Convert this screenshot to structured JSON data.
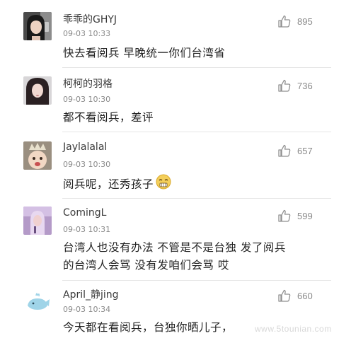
{
  "comments": [
    {
      "username": "乖乖的GHYJ",
      "time": "09-03 10:33",
      "text_lines": [
        "快去看阅兵 早晚统一你们台湾省"
      ],
      "likes": "895",
      "avatar_icon": "avatar-girl-dark-hair-photo"
    },
    {
      "username": "柯柯的羽格",
      "time": "09-03 10:30",
      "text_lines": [
        "都不看阅兵，差评"
      ],
      "likes": "736",
      "avatar_icon": "avatar-girl-long-hair-photo"
    },
    {
      "username": "Jaylalalal",
      "time": "09-03 10:30",
      "text_lines": [
        "阅兵呢，还秀孩子"
      ],
      "likes": "657",
      "avatar_icon": "avatar-baby-crown-photo",
      "emoji_icon": "smirk-emoji"
    },
    {
      "username": "ComingL",
      "time": "09-03 10:31",
      "text_lines": [
        "台湾人也没有办法 不管是不是台独 发了阅兵",
        "的台湾人会骂 没有发咱们会骂 哎"
      ],
      "likes": "599",
      "avatar_icon": "avatar-singer-purple-photo"
    },
    {
      "username": "April_静jing",
      "time": "09-03 10:34",
      "text_lines": [
        "今天都在看阅兵，台独你晒儿子，"
      ],
      "likes": "660",
      "avatar_icon": "avatar-whale-cartoon"
    }
  ],
  "like_icon": "thumbs-up-icon",
  "watermark": "www.5tounian.com"
}
